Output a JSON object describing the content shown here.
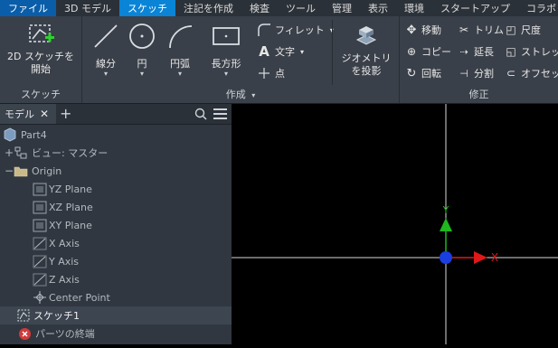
{
  "menu": {
    "tabs": [
      {
        "label": "ファイル"
      },
      {
        "label": "3D モデル"
      },
      {
        "label": "スケッチ"
      },
      {
        "label": "注記を作成"
      },
      {
        "label": "検査"
      },
      {
        "label": "ツール"
      },
      {
        "label": "管理"
      },
      {
        "label": "表示"
      },
      {
        "label": "環境"
      },
      {
        "label": "スタートアップ"
      },
      {
        "label": "コラボレーション"
      }
    ]
  },
  "ribbon": {
    "sketch_panel": {
      "title": "スケッチ",
      "start_sketch_line1": "2D スケッチを",
      "start_sketch_line2": "開始"
    },
    "create_panel": {
      "title": "作成",
      "line": "線分",
      "circle": "円",
      "arc": "円弧",
      "rectangle": "長方形",
      "fillet": "フィレット",
      "text": "文字",
      "point": "点",
      "project_line1": "ジオメトリ",
      "project_line2": "を投影"
    },
    "modify_panel": {
      "title": "修正",
      "move": "移動",
      "trim": "トリム",
      "scale": "尺度",
      "copy": "コピー",
      "extend": "延長",
      "stretch": "ストレッチ",
      "rotate": "回転",
      "split": "分割",
      "offset": "オフセット"
    }
  },
  "browser": {
    "tab_label": "モデル",
    "items": [
      {
        "label": "Part4"
      },
      {
        "label": "ビュー: マスター"
      },
      {
        "label": "Origin"
      },
      {
        "label": "YZ Plane"
      },
      {
        "label": "XZ Plane"
      },
      {
        "label": "XY Plane"
      },
      {
        "label": "X Axis"
      },
      {
        "label": "Y Axis"
      },
      {
        "label": "Z Axis"
      },
      {
        "label": "Center Point"
      },
      {
        "label": "スケッチ1"
      },
      {
        "label": "パーツの終端"
      }
    ]
  },
  "viewport": {
    "axis_y_label": "Y",
    "axis_x_label": "X",
    "colors": {
      "y_axis": "#1fb81f",
      "x_axis": "#e01818",
      "origin": "#1a3ee0",
      "grid": "#d9d9d9"
    }
  }
}
